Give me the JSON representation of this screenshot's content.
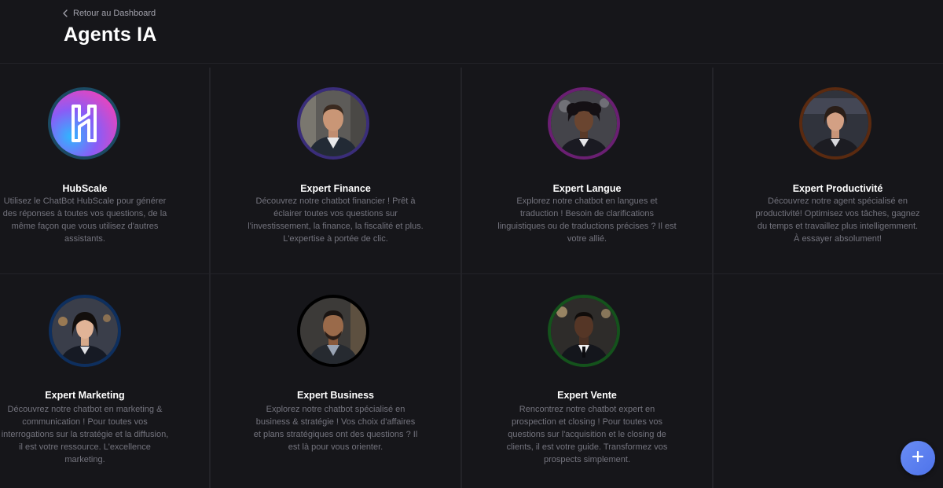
{
  "header": {
    "back_label": "Retour au Dashboard",
    "title": "Agents IA"
  },
  "agents": [
    {
      "name": "HubScale",
      "description": "Utilisez le ChatBot HubScale pour générer des réponses à toutes vos questions, de la même façon que vous utilisez d'autres assistants.",
      "ring_color": "#1b4a63",
      "icon": "hubscale-logo"
    },
    {
      "name": "Expert Finance",
      "description": "Découvrez notre chatbot financier ! Prêt à éclairer toutes vos questions sur l'investissement, la finance, la fiscalité et plus. L'expertise à portée de clic.",
      "ring_color": "#3a2d7a",
      "icon": "man-portrait"
    },
    {
      "name": "Expert Langue",
      "description": "Explorez notre chatbot en langues et traduction ! Besoin de clarifications linguistiques ou de traductions précises ? Il est votre allié.",
      "ring_color": "#6a1f72",
      "icon": "woman-portrait"
    },
    {
      "name": "Expert Productivité",
      "description": "Découvrez notre agent spécialisé en productivité! Optimisez vos tâches, gagnez du temps et travaillez plus intelligemment. À essayer absolument!",
      "ring_color": "#5a2a10",
      "icon": "woman-portrait"
    },
    {
      "name": "Expert Marketing",
      "description": "Découvrez notre chatbot en marketing & communication ! Pour toutes vos interrogations sur la stratégie et la diffusion, il est votre ressource. L'excellence marketing.",
      "ring_color": "#0e2f5e",
      "icon": "woman-portrait"
    },
    {
      "name": "Expert Business",
      "description": "Explorez notre chatbot spécialisé en business & stratégie ! Vos choix d'affaires et plans stratégiques ont des questions ? Il est là pour vous orienter.",
      "ring_color": "#000000",
      "icon": "man-portrait"
    },
    {
      "name": "Expert Vente",
      "description": "Rencontrez notre chatbot expert en prospection et closing ! Pour toutes vos questions sur l'acquisition et le closing de clients, il est votre guide. Transformez vos prospects simplement.",
      "ring_color": "#14521c",
      "icon": "man-portrait"
    }
  ],
  "fab": {
    "icon": "plus-icon",
    "color": "#5b80ef"
  }
}
